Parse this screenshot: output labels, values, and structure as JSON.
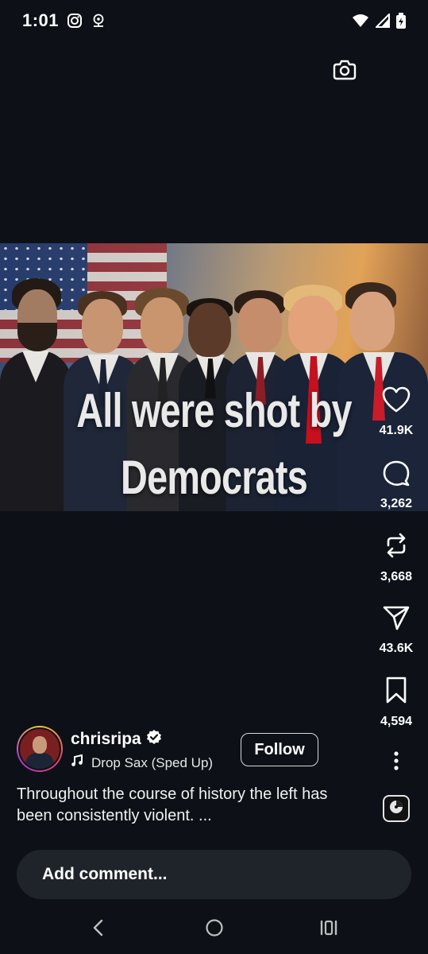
{
  "status_bar": {
    "time": "1:01",
    "icons": [
      "instagram-icon",
      "webcam-icon",
      "wifi-icon",
      "signal-icon",
      "battery-charging-icon"
    ]
  },
  "post": {
    "overlay_text_line1": "All were shot by",
    "overlay_text_line2": "Democrats"
  },
  "actions": {
    "likes": "41.9K",
    "comments": "3,262",
    "reposts": "3,668",
    "shares": "43.6K",
    "saves": "4,594"
  },
  "author": {
    "username": "chrisripa",
    "verified": true,
    "music": "Drop Sax (Sped Up)"
  },
  "follow_label": "Follow",
  "caption": "Throughout the course of history the left has been consistently violent. ...",
  "comment_placeholder": "Add comment...",
  "colors": {
    "background": "#0d1117",
    "comment_bar": "#1f242b",
    "verified_badge": "#ffffff"
  }
}
